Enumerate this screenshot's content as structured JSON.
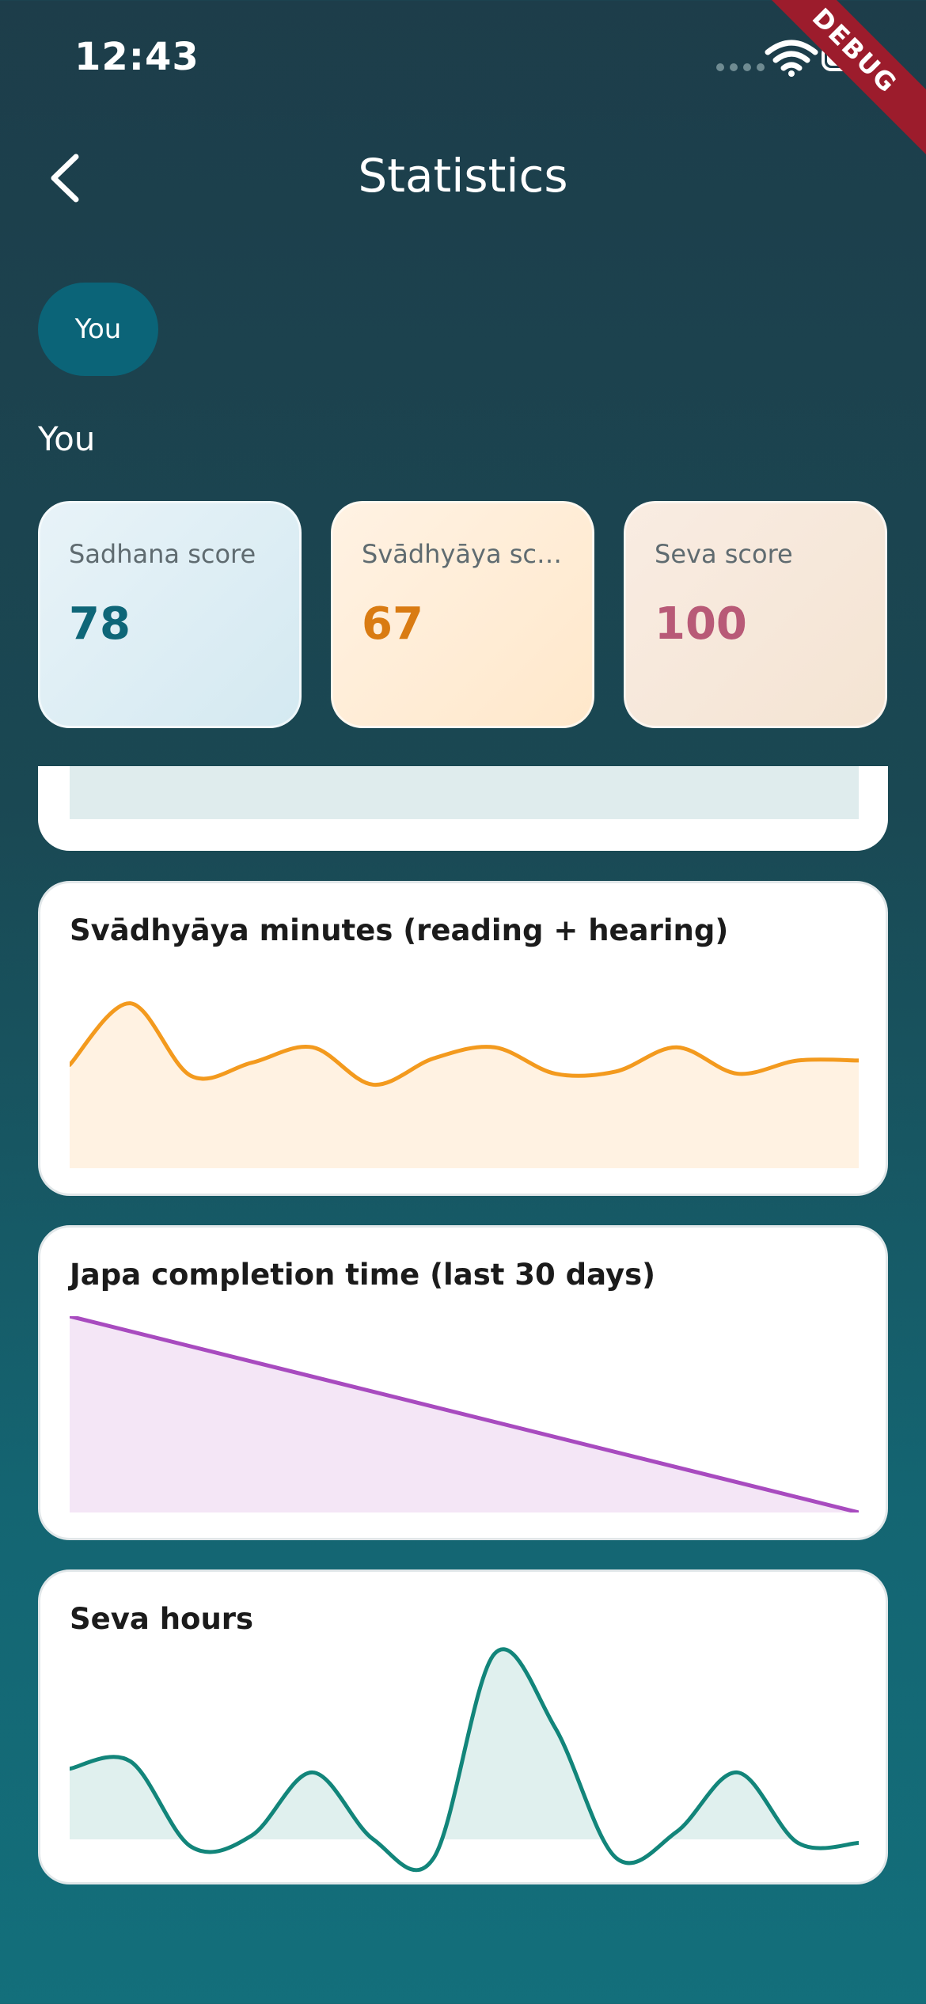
{
  "status_bar": {
    "time": "12:43",
    "debug_banner": "DEBUG"
  },
  "appbar": {
    "title": "Statistics"
  },
  "filter_chip": {
    "label": "You"
  },
  "section_label": "You",
  "scores": [
    {
      "label": "Sadhana score",
      "value": "78",
      "color": "#0e6678"
    },
    {
      "label": "Svādhyāya score",
      "value": "67",
      "color": "#d97b12"
    },
    {
      "label": "Seva score",
      "value": "100",
      "color": "#b85a77"
    }
  ],
  "chart_data": [
    {
      "type": "area",
      "title": "Svādhyāya minutes (reading + hearing)",
      "color": "#f39a1e",
      "fill": "#fff2e2",
      "x": [
        0,
        1,
        2,
        3,
        4,
        5,
        6,
        7,
        8,
        9,
        10,
        11,
        12,
        13
      ],
      "values": [
        47,
        75,
        42,
        48,
        55,
        38,
        50,
        55,
        43,
        44,
        55,
        43,
        49,
        49
      ],
      "ylim": [
        0,
        90
      ]
    },
    {
      "type": "area",
      "title": "Japa completion time (last 30 days)",
      "color": "#a84bbf",
      "fill": "#f4e6f6",
      "x": [
        0,
        29
      ],
      "values": [
        100,
        0
      ],
      "ylim": [
        0,
        100
      ]
    },
    {
      "type": "area",
      "title": "Seva hours",
      "color": "#12857a",
      "fill": "#e0f0ee",
      "x": [
        0,
        1,
        2,
        3,
        4,
        5,
        6,
        7,
        8,
        9,
        10,
        11,
        12,
        13
      ],
      "values": [
        2.4,
        2.6,
        0.3,
        0.6,
        2.3,
        0.5,
        0.0,
        5.5,
        3.5,
        0.0,
        0.7,
        2.3,
        0.4,
        0.4
      ],
      "ylim": [
        -0.4,
        6
      ]
    }
  ]
}
